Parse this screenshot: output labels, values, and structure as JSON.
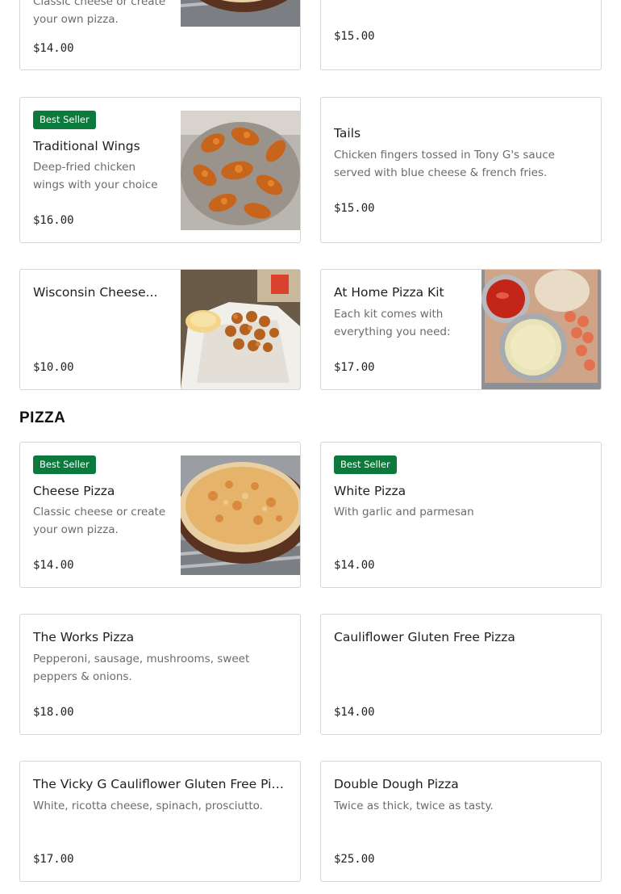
{
  "sections": {
    "pizza_heading": "PIZZA"
  },
  "badge_label": "Best Seller",
  "top_items": [
    {
      "desc": "Classic cheese or create your own pizza.",
      "price": "$14.00"
    },
    {
      "price": "$15.00"
    },
    {
      "badge": "Best Seller",
      "name": "Traditional Wings",
      "desc": "Deep-fried chicken wings with your choice of sauce.",
      "price": "$16.00"
    },
    {
      "name": "Tails",
      "desc": "Chicken fingers tossed in Tony G's sauce served with blue cheese & french fries.",
      "price": "$15.00"
    },
    {
      "name": "Wisconsin Cheese...",
      "price": "$10.00"
    },
    {
      "name": "At Home Pizza Kit",
      "desc": "Each kit comes with everything you need: fre...",
      "price": "$17.00"
    }
  ],
  "pizza_items": [
    {
      "badge": "Best Seller",
      "name": "Cheese Pizza",
      "desc": "Classic cheese or create your own pizza.",
      "price": "$14.00"
    },
    {
      "badge": "Best Seller",
      "name": "White Pizza",
      "desc": "With garlic and parmesan",
      "price": "$14.00"
    },
    {
      "name": "The Works Pizza",
      "desc": "Pepperoni, sausage, mushrooms, sweet peppers & onions.",
      "price": "$18.00"
    },
    {
      "name": "Cauliflower Gluten Free Pizza",
      "price": "$14.00"
    },
    {
      "name": "The Vicky G Cauliflower Gluten Free Pizza",
      "desc": "White, ricotta cheese, spinach, prosciutto.",
      "price": "$17.00"
    },
    {
      "name": "Double Dough Pizza",
      "desc": "Twice as thick, twice as tasty.",
      "price": "$25.00"
    }
  ],
  "colors": {
    "badge_bg": "#0c7a3c",
    "card_border": "#d6d6d6",
    "text_muted": "#6b6b6b"
  },
  "images": {
    "cheese_pizza": "pizza-photo",
    "wings": "chicken-wings-photo",
    "cheese_curds": "cheese-curds-photo",
    "pizza_kit": "pizza-kit-photo"
  }
}
